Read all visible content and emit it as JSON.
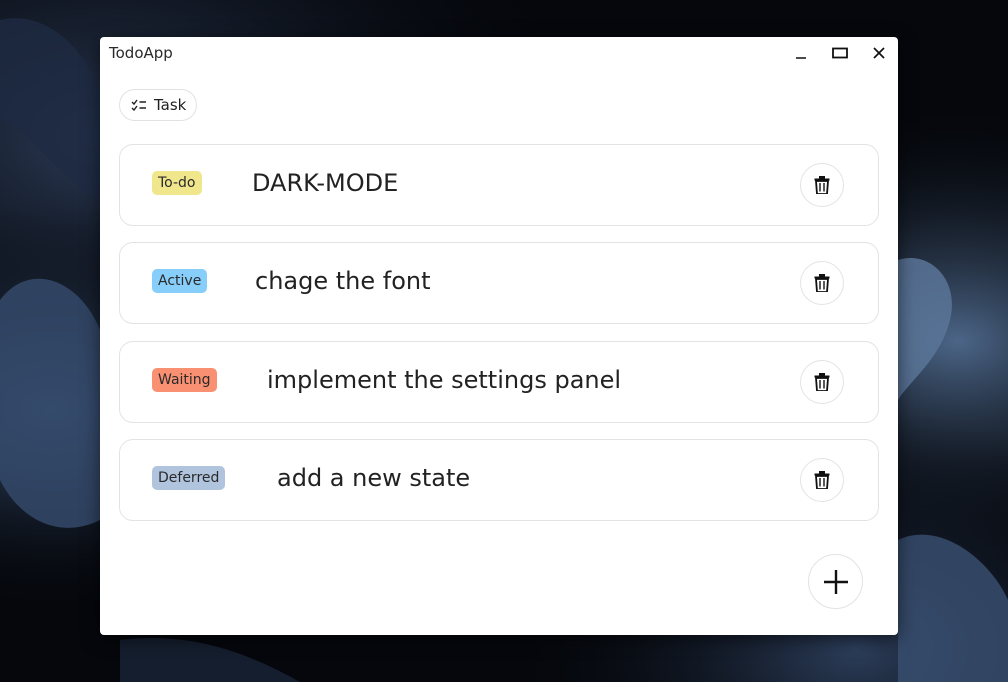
{
  "window": {
    "title": "TodoApp"
  },
  "toolbar": {
    "task_label": "Task"
  },
  "todos": [
    {
      "status": "To-do",
      "status_color": "#f0e68c",
      "text": "DARK-MODE"
    },
    {
      "status": "Active",
      "status_color": "#87cefa",
      "text": "chage the font"
    },
    {
      "status": "Waiting",
      "status_color": "#fa9072",
      "text": "implement the settings panel"
    },
    {
      "status": "Deferred",
      "status_color": "#b0c4de",
      "text": "add a new state"
    }
  ],
  "icons": {
    "minimize": "minimize-icon",
    "maximize": "maximize-icon",
    "close": "close-icon",
    "task": "checklist-icon",
    "delete": "trash-icon",
    "add": "plus-icon"
  }
}
